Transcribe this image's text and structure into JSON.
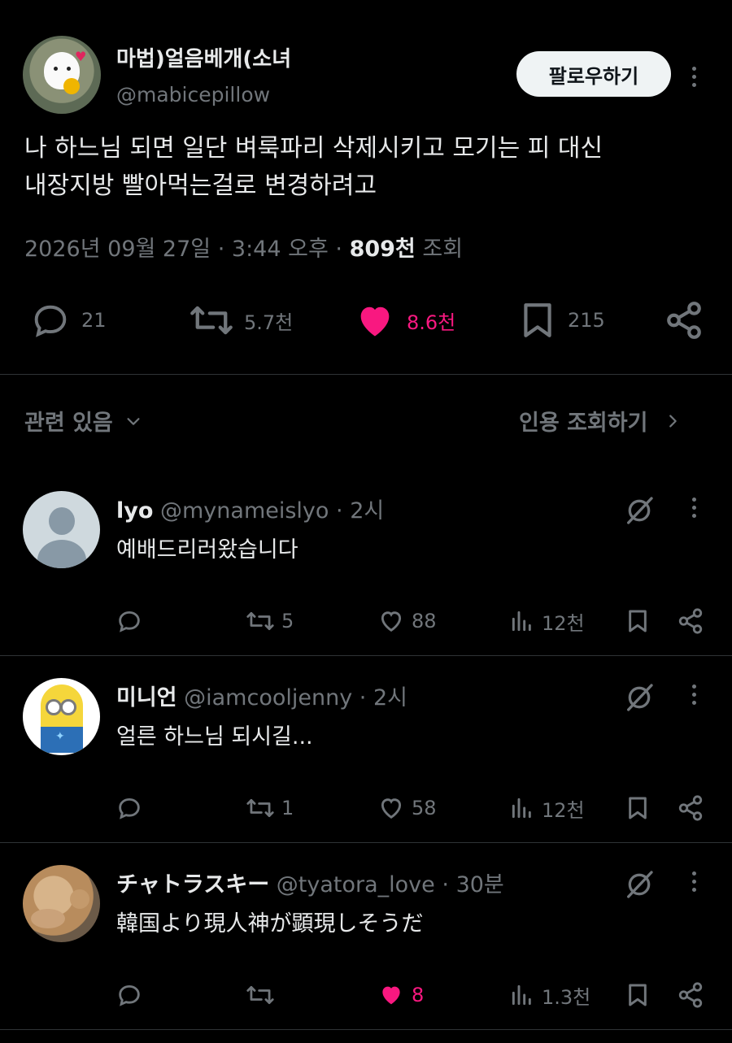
{
  "post": {
    "display_name": "마법)얼음베개(소녀",
    "handle": "@mabicepillow",
    "follow_label": "팔로우하기",
    "text_line1": "나 하느님 되면 일단 벼룩파리 삭제시키고 모기는 피 대신",
    "text_line2": "내장지방 빨아먹는걸로 변경하려고",
    "date": "2026년 09월 27일",
    "time": "3:44 오후",
    "views_count": "809천",
    "views_label": "조회",
    "replies": "21",
    "reposts": "5.7천",
    "likes": "8.6천",
    "bookmarks": "215"
  },
  "related": {
    "label": "관련 있음",
    "quote_link": "인용 조회하기"
  },
  "replies": [
    {
      "name": "lyo",
      "handle": "@mynameislyo",
      "time": "2시",
      "text": "예배드리러왔습니다",
      "reply_count": "",
      "repost_count": "5",
      "like_count": "88",
      "view_count": "12천",
      "liked": false
    },
    {
      "name": "미니언",
      "handle": "@iamcooljenny",
      "time": "2시",
      "text": "얼른 하느님 되시길...",
      "reply_count": "",
      "repost_count": "1",
      "like_count": "58",
      "view_count": "12천",
      "liked": false
    },
    {
      "name": "チャトラスキー",
      "handle": "@tyatora_love",
      "time": "30분",
      "text": "韓国より現人神が顕現しそうだ",
      "reply_count": "",
      "repost_count": "",
      "like_count": "8",
      "view_count": "1.3천",
      "liked": true
    }
  ],
  "colors": {
    "background": "#000000",
    "text": "#e7e9ea",
    "muted": "#71767b",
    "like": "#f91880",
    "divider": "#2f3336"
  },
  "icons": [
    "reply-icon",
    "repost-icon",
    "like-icon",
    "bookmark-icon",
    "share-icon",
    "views-icon",
    "grok-icon",
    "more-icon",
    "chevron-down-icon",
    "chevron-right-icon"
  ]
}
